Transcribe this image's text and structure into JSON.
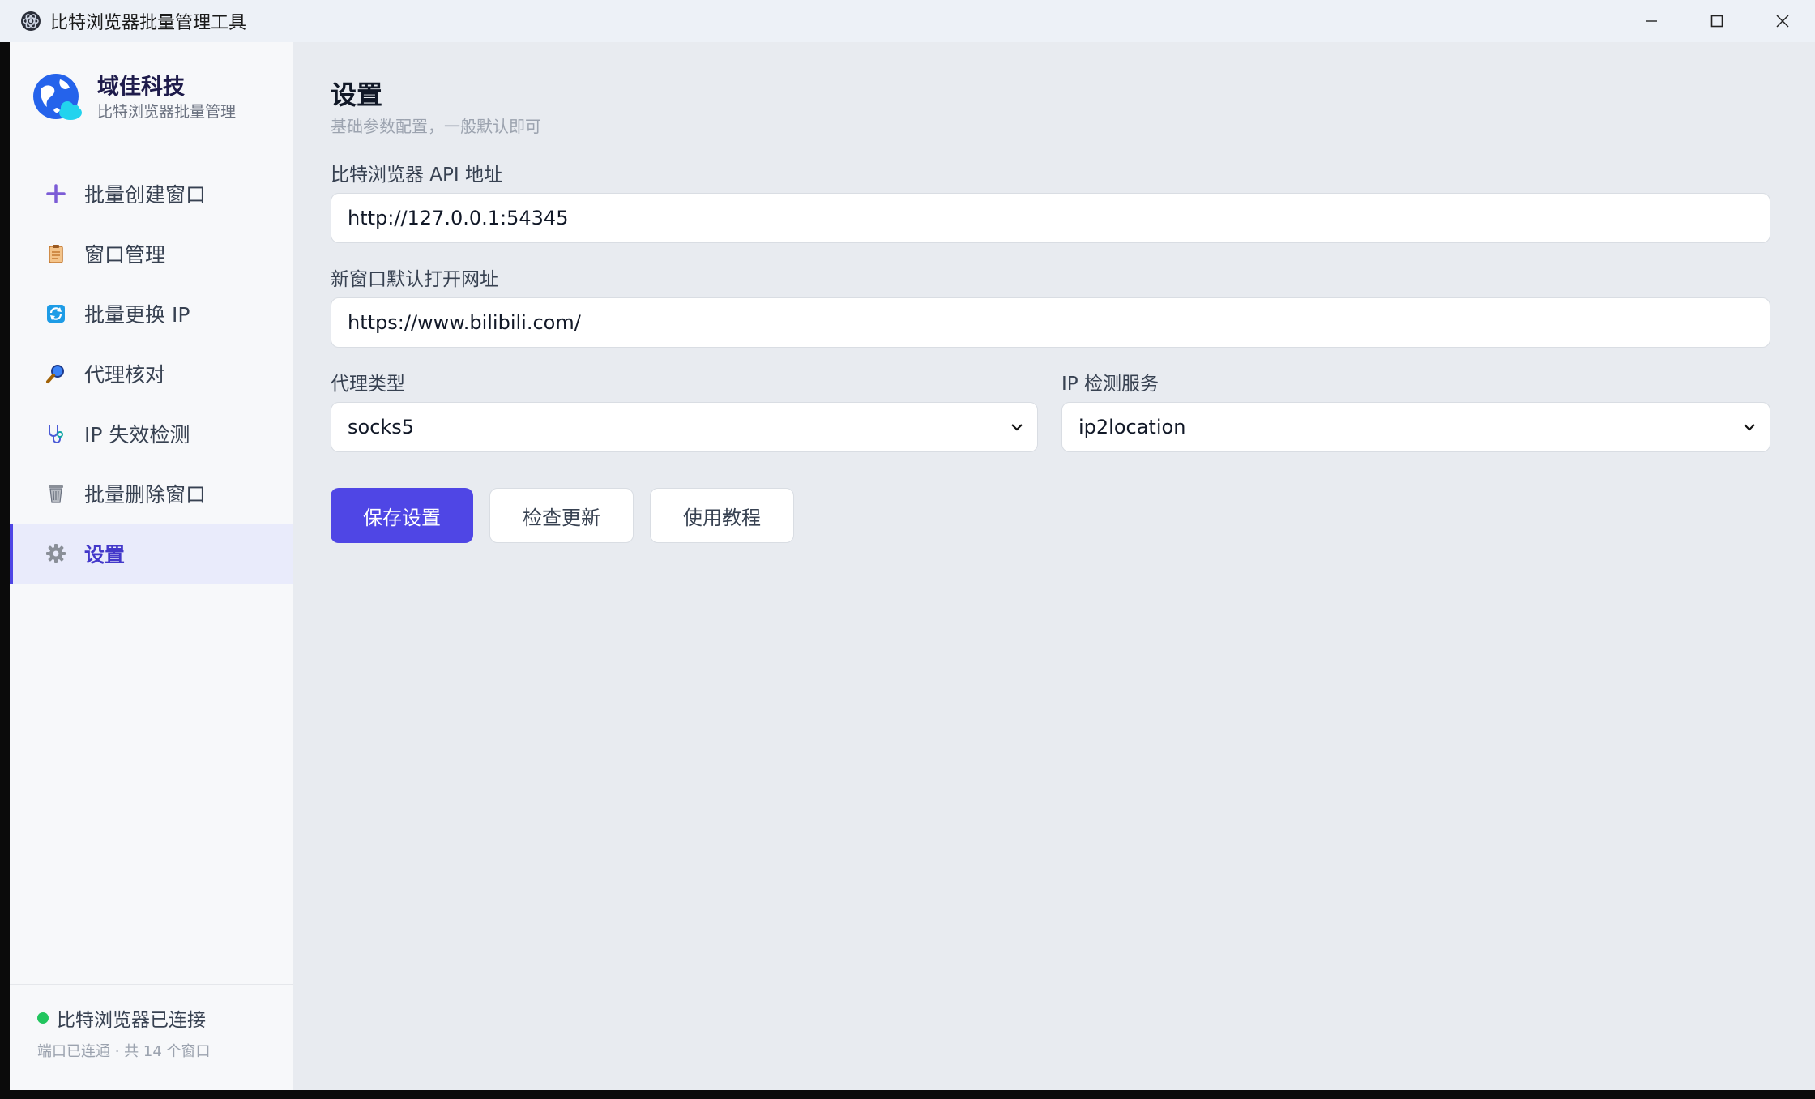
{
  "window": {
    "title": "比特浏览器批量管理工具"
  },
  "brand": {
    "name": "域佳科技",
    "subtitle": "比特浏览器批量管理"
  },
  "nav": {
    "items": [
      {
        "label": "批量创建窗口",
        "icon": "plus-icon"
      },
      {
        "label": "窗口管理",
        "icon": "clipboard-icon"
      },
      {
        "label": "批量更换 IP",
        "icon": "refresh-icon"
      },
      {
        "label": "代理核对",
        "icon": "magnifier-icon"
      },
      {
        "label": "IP 失效检测",
        "icon": "stethoscope-icon"
      },
      {
        "label": "批量删除窗口",
        "icon": "trash-icon"
      },
      {
        "label": "设置",
        "icon": "gear-icon",
        "active": true
      }
    ]
  },
  "status": {
    "text": "比特浏览器已连接",
    "sub": "端口已连通 · 共 14 个窗口",
    "color": "#22c55e"
  },
  "page": {
    "title": "设置",
    "subtitle": "基础参数配置，一般默认即可"
  },
  "form": {
    "api_label": "比特浏览器 API 地址",
    "api_value": "http://127.0.0.1:54345",
    "url_label": "新窗口默认打开网址",
    "url_value": "https://www.bilibili.com/",
    "proxy_label": "代理类型",
    "proxy_value": "socks5",
    "ipcheck_label": "IP 检测服务",
    "ipcheck_value": "ip2location"
  },
  "buttons": {
    "save": "保存设置",
    "check_update": "检查更新",
    "tutorial": "使用教程"
  },
  "colors": {
    "accent": "#4f46e5",
    "active_bg": "#e9ebfb",
    "content_bg": "#e8ebf0"
  }
}
